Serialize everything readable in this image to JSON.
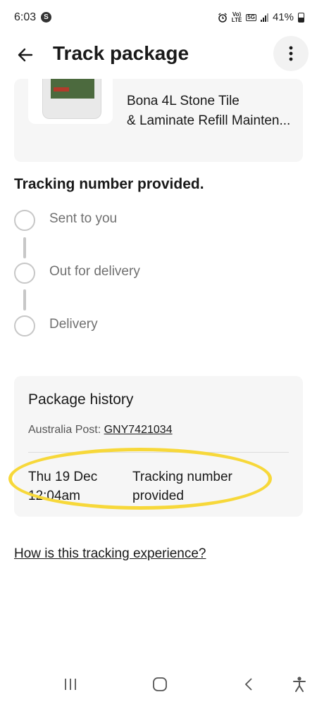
{
  "status_bar": {
    "time": "6:03",
    "notification_badge": "S",
    "volte": "Vo)\nLTE",
    "network": "5G",
    "battery": "41%",
    "icons": [
      "alarm-icon",
      "signal-icon",
      "battery-icon"
    ]
  },
  "header": {
    "title": "Track package",
    "icons": [
      "back-arrow-icon",
      "more-vertical-icon"
    ]
  },
  "product": {
    "title_line1": "Bona 4L Stone Tile",
    "title_line2": "& Laminate Refill Mainten..."
  },
  "tracking": {
    "heading": "Tracking number provided.",
    "steps": [
      {
        "label": "Sent to you"
      },
      {
        "label": "Out for delivery"
      },
      {
        "label": "Delivery"
      }
    ]
  },
  "history": {
    "title": "Package history",
    "carrier_label": "Australia Post:",
    "tracking_number": "GNY7421034",
    "events": [
      {
        "date": "Thu 19 Dec",
        "time": "12:04am",
        "status_line1": "Tracking number",
        "status_line2": "provided"
      }
    ],
    "highlight_color": "#f7d83a"
  },
  "feedback": {
    "link_text": "How is this tracking experience?"
  },
  "nav_bar": {
    "icons": [
      "recent-apps-icon",
      "home-icon",
      "back-icon",
      "accessibility-icon"
    ]
  }
}
